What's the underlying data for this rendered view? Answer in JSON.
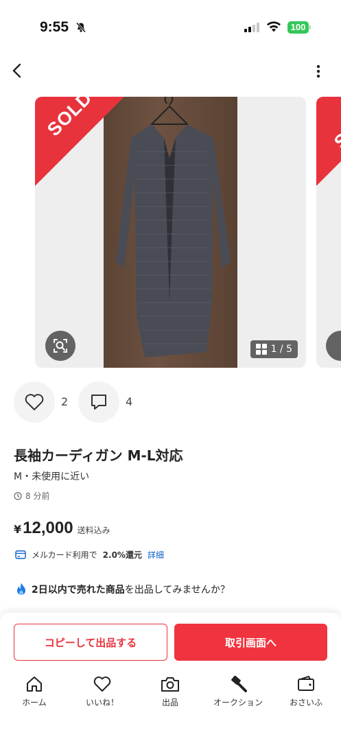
{
  "status_bar": {
    "time": "9:55",
    "battery": "100"
  },
  "gallery": {
    "sold_label": "SOLD",
    "counter": "1 / 5"
  },
  "actions": {
    "likes": "2",
    "comments": "4"
  },
  "item": {
    "title": "長袖カーディガン M-L対応",
    "condition": "M・未使用に近い",
    "posted": "8 分前",
    "price_symbol": "¥",
    "price": "12,000",
    "shipping": "送料込み"
  },
  "mercard": {
    "prefix": "メルカード利用で",
    "rate": "2.0%還元",
    "link": "詳細"
  },
  "promo": {
    "bold": "2日以内で売れた商品",
    "rest": "を出品してみませんか？"
  },
  "buttons": {
    "copy": "コピーして出品する",
    "deal": "取引画面へ"
  },
  "tabbar": [
    {
      "label": "ホーム",
      "icon": "home-icon"
    },
    {
      "label": "いいね！",
      "icon": "heart-icon"
    },
    {
      "label": "出品",
      "icon": "camera-icon"
    },
    {
      "label": "オークション",
      "icon": "gavel-icon"
    },
    {
      "label": "おさいふ",
      "icon": "wallet-icon"
    }
  ],
  "colors": {
    "accent": "#f0343f",
    "sold": "#e8333d",
    "link": "#0a60c8",
    "battery": "#34c759"
  }
}
